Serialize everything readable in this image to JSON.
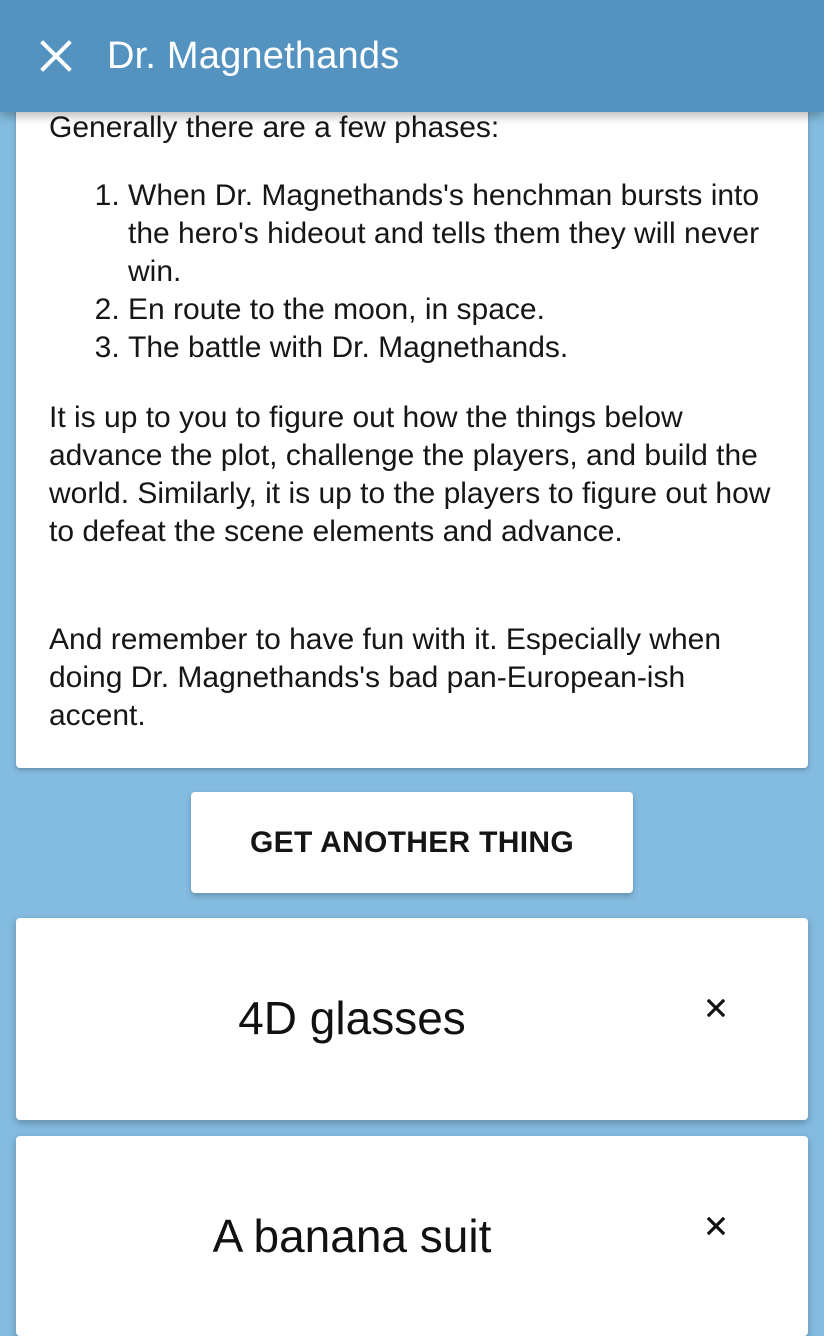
{
  "header": {
    "title": "Dr. Magnethands",
    "close_icon": "close-icon"
  },
  "description": {
    "intro": "Generally there are a few phases:",
    "phases": [
      "When Dr. Magnethands's henchman bursts into the hero's hideout and tells them they will never win.",
      "En route to the moon, in space.",
      "The battle with Dr. Magnethands."
    ],
    "paragraph_1": "It is up to you to figure out how the things below advance the plot, challenge the players, and build the world. Similarly, it is up to the players to figure out how to defeat the scene elements and advance.",
    "paragraph_2": "And remember to have fun with it. Especially when doing Dr. Magnethands's bad pan-European-ish accent."
  },
  "actions": {
    "get_another_label": "GET ANOTHER THING"
  },
  "things": [
    {
      "label": "4D glasses",
      "remove_icon": "close-icon"
    },
    {
      "label": "A banana suit",
      "remove_icon": "close-icon"
    }
  ],
  "colors": {
    "app_bar": "#5493c0",
    "background": "#84bbe0",
    "card": "#ffffff"
  }
}
